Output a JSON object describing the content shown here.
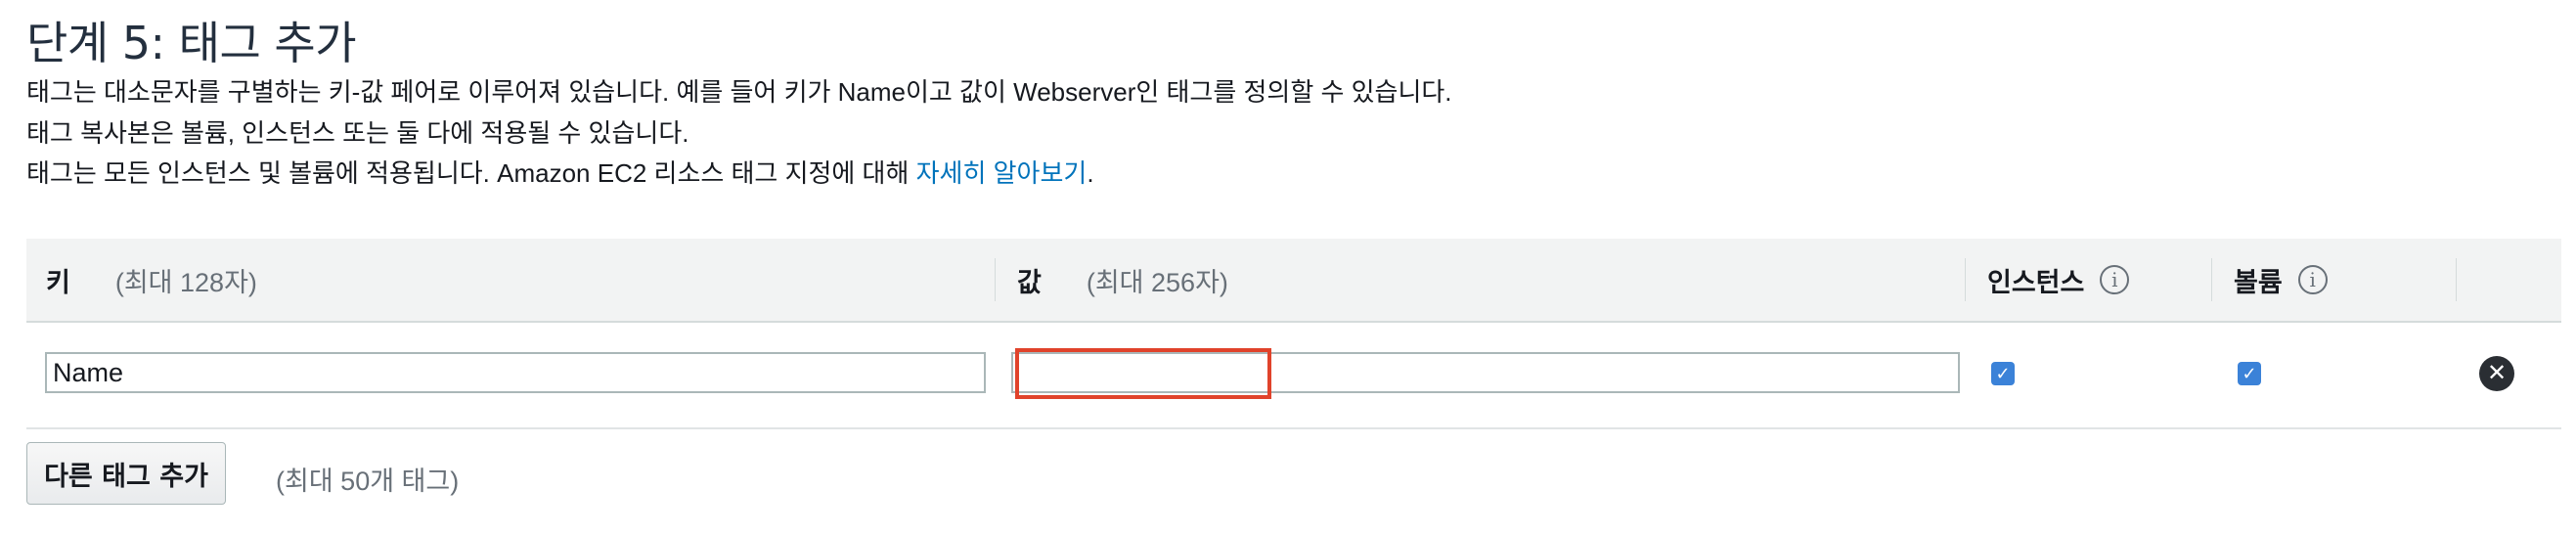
{
  "page": {
    "title": "단계 5: 태그 추가",
    "lines": [
      "태그는 대소문자를 구별하는 키-값 페어로 이루어져 있습니다. 예를 들어 키가 Name이고 값이 Webserver인 태그를 정의할 수 있습니다.",
      "태그 복사본은 볼륨, 인스턴스 또는 둘 다에 적용될 수 있습니다."
    ],
    "line3_prefix": "태그는 모든 인스턴스 및 볼륨에 적용됩니다. Amazon EC2 리소스 태그 지정에 대해 ",
    "line3_link": "자세히 알아보기",
    "line3_suffix": "."
  },
  "table": {
    "headers": {
      "key": "키",
      "key_hint": "(최대 128자)",
      "value": "값",
      "value_hint": "(최대 256자)",
      "instances": "인스턴스",
      "volumes": "볼륨"
    },
    "rows": [
      {
        "key": "Name",
        "value": "",
        "instances_checked": true,
        "volumes_checked": true
      }
    ]
  },
  "actions": {
    "add_tag_label": "다른 태그 추가",
    "limit_hint": "(최대 50개 태그)"
  },
  "colors": {
    "link": "#0073bb",
    "checkbox": "#3b82d8",
    "highlight": "#e0432b"
  },
  "icons": {
    "info": "info-icon",
    "remove": "close-circle-icon",
    "check": "check-icon"
  }
}
